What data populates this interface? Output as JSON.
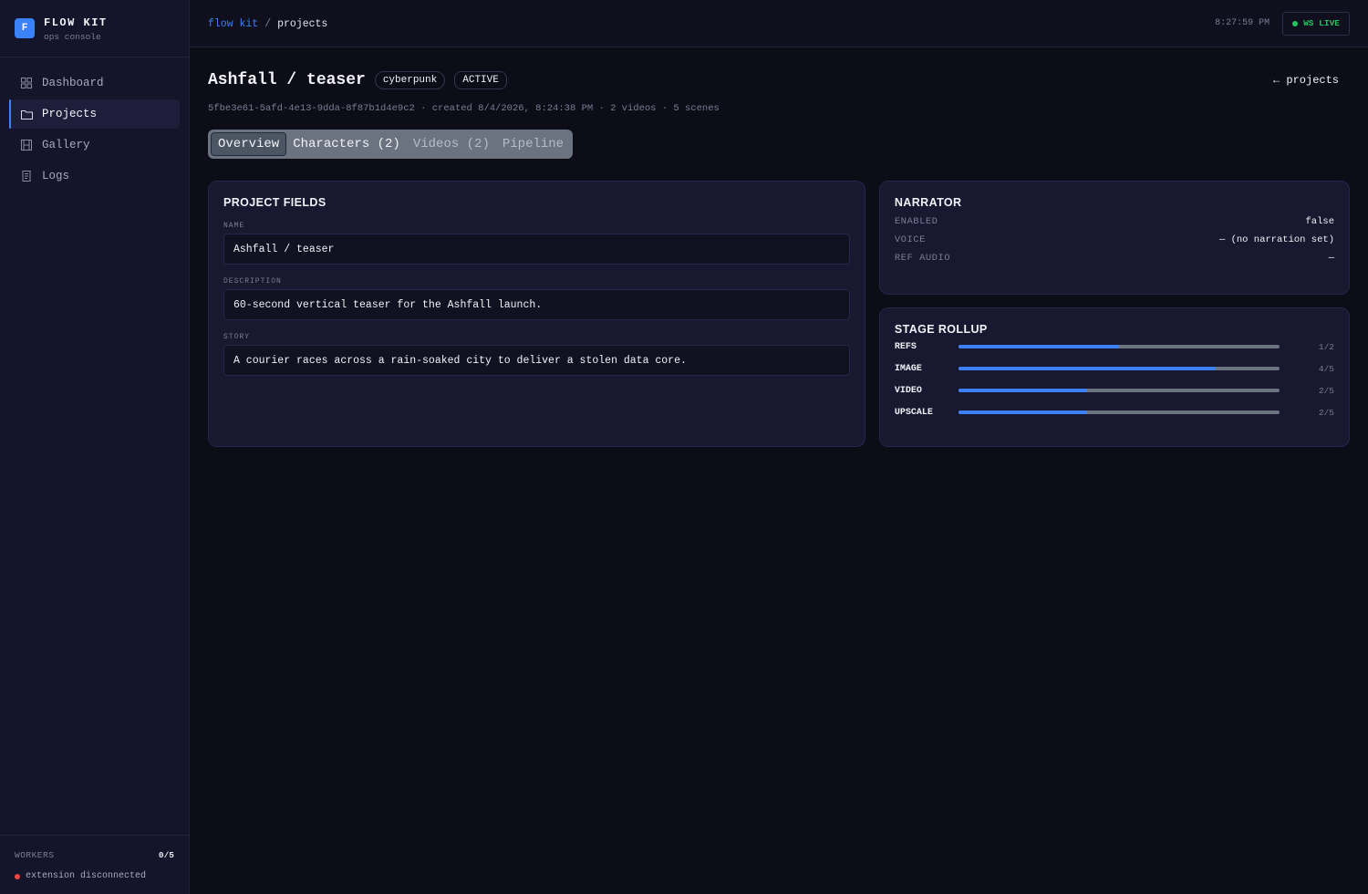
{
  "brand": {
    "logo": "F",
    "title": "FLOW KIT",
    "subtitle": "ops console"
  },
  "nav": [
    {
      "label": "Dashboard",
      "icon": "dashboard-icon",
      "active": false
    },
    {
      "label": "Projects",
      "icon": "folder-icon",
      "active": true
    },
    {
      "label": "Gallery",
      "icon": "film-icon",
      "active": false
    },
    {
      "label": "Logs",
      "icon": "logs-icon",
      "active": false
    }
  ],
  "footer": {
    "workers_label": "WORKERS",
    "workers_count": "0/5",
    "extension_status": "extension disconnected"
  },
  "topbar": {
    "breadcrumb_root": "flow kit",
    "breadcrumb_sep": "/",
    "breadcrumb_current": "projects",
    "clock": "8:27:59 PM",
    "ws_status": "WS LIVE"
  },
  "project": {
    "title": "Ashfall / teaser",
    "style_chip": "cyberpunk",
    "status_chip": "ACTIVE",
    "back_link": "← projects",
    "meta": "5fbe3e61-5afd-4e13-9dda-8f87b1d4e9c2 · created 8/4/2026, 8:24:38 PM · 2 videos · 5 scenes"
  },
  "tabs": [
    {
      "label": "Overview",
      "active": true
    },
    {
      "label": "Characters (2)",
      "active": false
    },
    {
      "label": "Videos (2)",
      "active": false
    },
    {
      "label": "Pipeline",
      "active": false
    }
  ],
  "fields_card": {
    "title": "PROJECT FIELDS",
    "name_label": "NAME",
    "name_value": "Ashfall / teaser",
    "description_label": "DESCRIPTION",
    "description_value": "60-second vertical teaser for the Ashfall launch.",
    "story_label": "STORY",
    "story_value": "A courier races across a rain-soaked city to deliver a stolen data core."
  },
  "narrator_card": {
    "title": "NARRATOR",
    "rows": [
      {
        "key": "ENABLED",
        "value": "false"
      },
      {
        "key": "VOICE",
        "value": "— (no narration set)"
      },
      {
        "key": "REF AUDIO",
        "value": "—"
      }
    ]
  },
  "rollup_card": {
    "title": "STAGE ROLLUP",
    "stages": [
      {
        "name": "REFS",
        "count": "1/2",
        "progress": 0.5
      },
      {
        "name": "IMAGE",
        "count": "4/5",
        "progress": 0.8
      },
      {
        "name": "VIDEO",
        "count": "2/5",
        "progress": 0.4
      },
      {
        "name": "UPSCALE",
        "count": "2/5",
        "progress": 0.4
      }
    ]
  },
  "colors": {
    "accent": "#3b82f6",
    "live": "#22c55e",
    "error": "#ef4444",
    "background": "#0d0d17",
    "card": "#181830"
  }
}
